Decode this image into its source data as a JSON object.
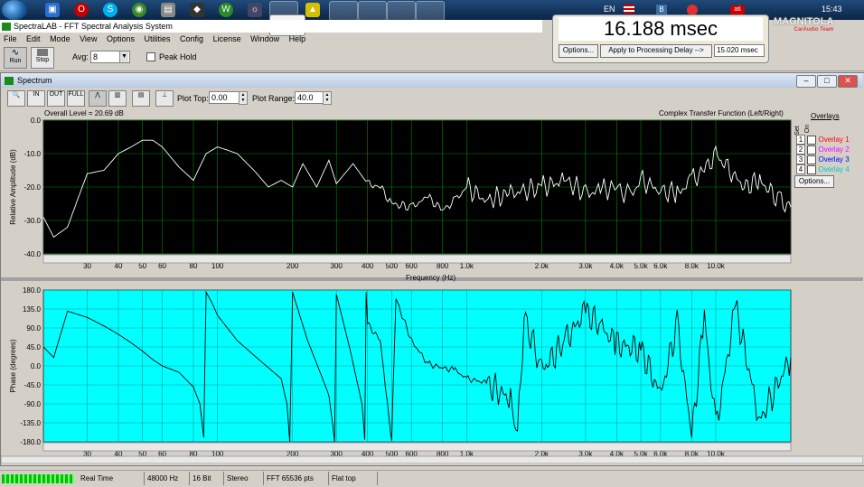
{
  "taskbar": {
    "stop_label": "Stop",
    "language": "EN",
    "clock": "15:43"
  },
  "app": {
    "title": "SpectraLAB - FFT Spectral Analysis System",
    "menu": [
      "File",
      "Edit",
      "Mode",
      "View",
      "Options",
      "Utilities",
      "Config",
      "License",
      "Window",
      "Help"
    ]
  },
  "toolbar": {
    "run_label": "Run",
    "stop_label": "Stop",
    "avg_label": "Avg:",
    "avg_value": "8",
    "peak_hold_label": "Peak Hold"
  },
  "delay_panel": {
    "value": "16.188 msec",
    "options_label": "Options...",
    "apply_label": "Apply to Processing Delay -->",
    "delay_field": "15.020 msec"
  },
  "watermark": {
    "brand": "MAGNITOLA",
    "sub": "CarAudio Team"
  },
  "spectrum_window": {
    "title": "Spectrum",
    "plot_top_label": "Plot Top:",
    "plot_top_value": "0.00",
    "plot_range_label": "Plot Range:",
    "plot_range_value": "40.0",
    "overall_level": "Overall Level = 20.69 dB",
    "function_label": "Complex Transfer Function (Left/Right)",
    "overlays_title": "Overlays",
    "overlays_col_set": "Set",
    "overlays_col_on": "On",
    "overlays": [
      {
        "num": "1",
        "name": "Overlay 1",
        "color": "#ff0000"
      },
      {
        "num": "2",
        "name": "Overlay 2",
        "color": "#ff00ff"
      },
      {
        "num": "3",
        "name": "Overlay 3",
        "color": "#0000ff"
      },
      {
        "num": "4",
        "name": "Overlay 4",
        "color": "#00c8c8"
      }
    ],
    "overlays_options": "Options...",
    "frequency_label": "Frequency (Hz)"
  },
  "chart_data": [
    {
      "type": "line",
      "ylabel": "Relative Amplitude (dB)",
      "xlabel": "Frequency (Hz)",
      "xscale": "log",
      "ylim": [
        -40,
        0
      ],
      "yticks": [
        "0.0",
        "-10.0",
        "-20.0",
        "-30.0",
        "-40.0"
      ],
      "xticks": [
        "30",
        "40",
        "50",
        "60",
        "80",
        "100",
        "200",
        "300",
        "400",
        "500",
        "600",
        "800",
        "1.0k",
        "2.0k",
        "3.0k",
        "4.0k",
        "5.0k",
        "6.0k",
        "8.0k",
        "10.0k"
      ],
      "background": "#000000",
      "line_color": "#ffffff",
      "grid_color": "#00a000",
      "x": [
        20,
        22,
        25,
        28,
        30,
        35,
        40,
        45,
        50,
        55,
        60,
        70,
        80,
        90,
        100,
        110,
        120,
        140,
        160,
        180,
        200,
        220,
        250,
        280,
        300,
        350,
        400,
        450,
        500,
        600,
        700,
        800,
        900,
        1000,
        1200,
        1500,
        2000,
        2500,
        3000,
        3500,
        4000,
        4500,
        5000,
        6000,
        7000,
        8000,
        9000,
        10000,
        11000,
        13000,
        15000,
        18000,
        20000
      ],
      "y": [
        -29,
        -35,
        -32,
        -22,
        -16,
        -15,
        -10,
        -8,
        -6,
        -6,
        -8,
        -14,
        -18,
        -10,
        -8,
        -9,
        -10,
        -15,
        -20,
        -18,
        -20,
        -13,
        -20,
        -12,
        -19,
        -13,
        -19,
        -20,
        -25,
        -26,
        -23,
        -27,
        -24,
        -20,
        -24,
        -22,
        -20,
        -18,
        -22,
        -21,
        -20,
        -23,
        -18,
        -21,
        -22,
        -18,
        -15,
        -10,
        -14,
        -20,
        -18,
        -24,
        -26
      ],
      "series": [
        {
          "values": []
        }
      ]
    },
    {
      "type": "line",
      "ylabel": "Phase (degrees)",
      "xlabel": "Frequency (Hz)",
      "xscale": "log",
      "ylim": [
        -180,
        180
      ],
      "yticks": [
        "180.0",
        "135.0",
        "90.0",
        "45.0",
        "0.0",
        "-45.0",
        "-90.0",
        "-135.0",
        "-180.0"
      ],
      "xticks": [
        "30",
        "40",
        "50",
        "60",
        "80",
        "100",
        "200",
        "300",
        "400",
        "500",
        "600",
        "800",
        "1.0k",
        "2.0k",
        "3.0k",
        "4.0k",
        "5.0k",
        "6.0k",
        "8.0k",
        "10.0k"
      ],
      "background": "#00ffff",
      "line_color": "#000000",
      "x": [
        20,
        22,
        25,
        30,
        35,
        40,
        45,
        50,
        55,
        60,
        70,
        80,
        85,
        88,
        90,
        95,
        100,
        120,
        150,
        180,
        190,
        195,
        200,
        230,
        260,
        280,
        290,
        295,
        300,
        340,
        380,
        390,
        395,
        400,
        450,
        480,
        500,
        520,
        600,
        700,
        800,
        900,
        1000,
        1200,
        1500,
        1600,
        1700,
        2000,
        2500,
        3000,
        3500,
        4000,
        5000,
        6000,
        7000,
        8000,
        9000,
        10000,
        12000,
        15000,
        20000
      ],
      "y": [
        45,
        20,
        130,
        115,
        95,
        75,
        55,
        35,
        15,
        0,
        -15,
        -50,
        -90,
        -170,
        175,
        150,
        120,
        60,
        10,
        -30,
        -90,
        -180,
        175,
        60,
        -20,
        -70,
        -140,
        -180,
        170,
        40,
        -90,
        -175,
        175,
        100,
        60,
        -90,
        -178,
        160,
        60,
        5,
        -5,
        -10,
        -30,
        -40,
        -80,
        -175,
        120,
        -10,
        60,
        130,
        90,
        50,
        40,
        -70,
        100,
        -170,
        120,
        -150,
        140,
        -130,
        20
      ]
    }
  ],
  "statusbar": {
    "cells": [
      "Real Time",
      "48000 Hz",
      "16 Bit",
      "Stereo",
      "FFT 65536 pts",
      "Flat top"
    ]
  }
}
